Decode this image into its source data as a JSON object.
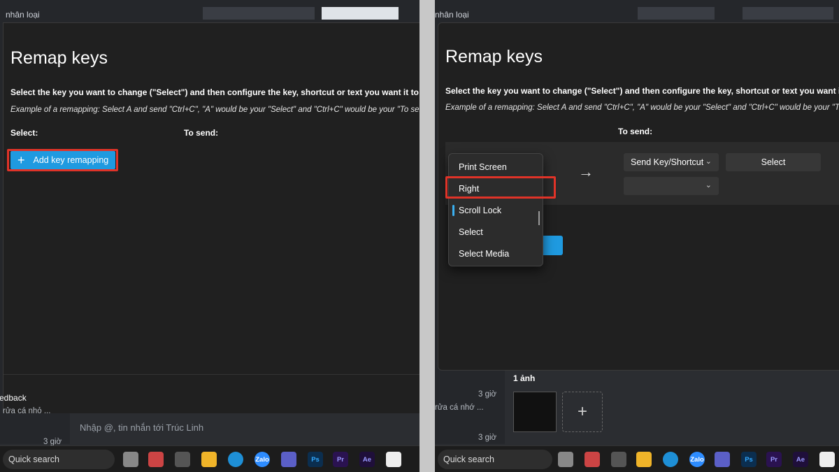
{
  "left": {
    "chat_header": "nhân loại",
    "dialog_title": "Remap keys",
    "instruction": "Select the key you want to change (\"Select\") and then configure the key, shortcut or text you want it to send.",
    "example": "Example of a remapping: Select A and send \"Ctrl+C\", \"A\" would be your \"Select\" and \"Ctrl+C\" would be your \"To send\".",
    "select_label": "Select:",
    "to_send_label": "To send:",
    "add_button_label": "Add key remapping",
    "footer_text": "Feedback",
    "chat_snippet": "rửa cá nhỏ ...",
    "chat_time": "3 giờ",
    "chat_input_placeholder": "Nhập @, tin nhắn tới Trúc Linh"
  },
  "right": {
    "chat_header": "nhân loại",
    "dialog_title": "Remap keys",
    "instruction": "Select the key you want to change (\"Select\") and then configure the key, shortcut or text you want it to send.",
    "example": "Example of a remapping: Select A and send \"Ctrl+C\", \"A\" would be your \"Select\" and \"Ctrl+C\" would be your \"To send\".",
    "to_send_label": "To send:",
    "send_type_dropdown": "Send Key/Shortcut",
    "select_button": "Select",
    "key_options": [
      "Print Screen",
      "Right",
      "Scroll Lock",
      "Select",
      "Select Media"
    ],
    "selected_option": "Scroll Lock",
    "photo_label": "1 ảnh",
    "chat_snippet": "rửa cá nhớ ...",
    "chat_time_1": "3 giờ",
    "chat_time_2": "3 giờ"
  },
  "taskbar": {
    "search_label": "Quick search",
    "apps": [
      "file-explorer",
      "edge",
      "zalo",
      "teams",
      "photoshop",
      "premiere",
      "after-effects"
    ]
  },
  "colors": {
    "accent_blue": "#1f9ae0",
    "highlight_red": "#e03328",
    "dialog_bg": "#202020"
  }
}
